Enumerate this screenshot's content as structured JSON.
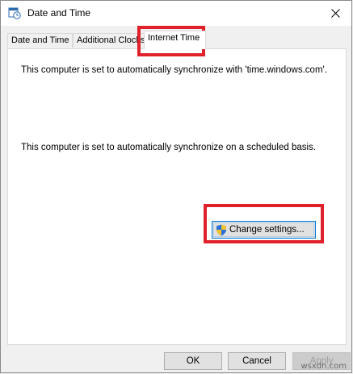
{
  "window": {
    "title": "Date and Time",
    "close_icon": "close-icon",
    "app_icon": "clock-calendar-icon"
  },
  "tabs": [
    {
      "label": "Date and Time",
      "active": false
    },
    {
      "label": "Additional Clocks",
      "active": false
    },
    {
      "label": "Internet Time",
      "active": true
    }
  ],
  "panel": {
    "sync_server_text": "This computer is set to automatically synchronize with 'time.windows.com'.",
    "schedule_text": "This computer is set to automatically synchronize on a scheduled basis.",
    "change_settings_label": "Change settings...",
    "change_settings_icon": "uac-shield-icon"
  },
  "footer": {
    "ok_label": "OK",
    "cancel_label": "Cancel",
    "apply_label": "Apply"
  },
  "annotation_color": "#e0202a",
  "watermark": "wsxdn.com"
}
